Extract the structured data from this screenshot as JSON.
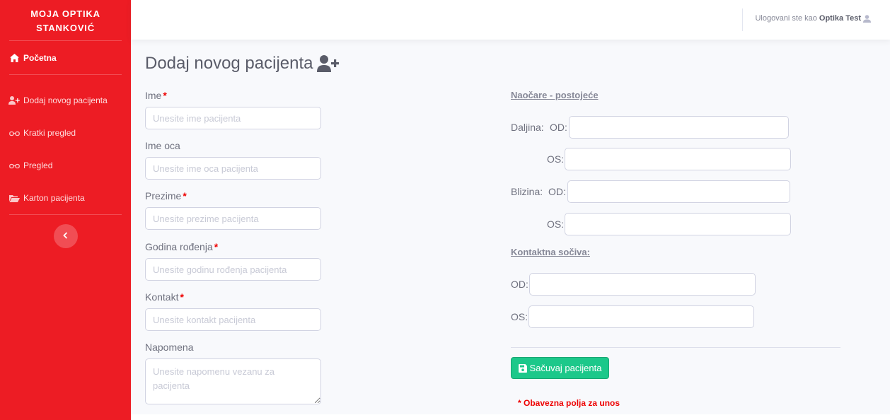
{
  "sidebar": {
    "brand_line1": "MOJA OPTIKA",
    "brand_line2": "STANKOVIĆ",
    "home": "Početna",
    "items": [
      {
        "label": "Dodaj novog pacijenta",
        "icon": "user-plus-icon"
      },
      {
        "label": "Kratki pregled",
        "icon": "glasses-icon"
      },
      {
        "label": "Pregled",
        "icon": "glasses-icon"
      },
      {
        "label": "Karton pacijenta",
        "icon": "folder-open-icon"
      }
    ],
    "accent": "#ed1c24"
  },
  "topbar": {
    "logged_prefix": "Ulogovani ste kao",
    "user_name": "Optika Test"
  },
  "page": {
    "title": "Dodaj novog pacijenta"
  },
  "form": {
    "ime": {
      "label": "Ime",
      "placeholder": "Unesite ime pacijenta",
      "required": "*"
    },
    "ime_oca": {
      "label": "Ime oca",
      "placeholder": "Unesite ime oca pacijenta"
    },
    "prezime": {
      "label": "Prezime",
      "placeholder": "Unesite prezime pacijenta",
      "required": "*"
    },
    "godina": {
      "label": "Godina rođenja",
      "placeholder": "Unesite godinu rođenja pacijenta",
      "required": "*"
    },
    "kontakt": {
      "label": "Kontakt",
      "placeholder": "Unesite kontakt pacijenta",
      "required": "*"
    },
    "napomena": {
      "label": "Napomena",
      "placeholder": "Unesite napomenu vezanu za pacijenta"
    }
  },
  "glasses": {
    "heading": "Naočare - postojeće",
    "daljina": "Daljina:",
    "blizina": "Blizina:",
    "od": "OD:",
    "os": "OS:"
  },
  "lenses": {
    "heading": "Kontaktna sočiva:",
    "od": "OD:",
    "os": "OS:"
  },
  "actions": {
    "save_label": "Sačuvaj pacijenta",
    "required_note": "* Obavezna polja za unos",
    "button_color": "#1cc88a"
  }
}
